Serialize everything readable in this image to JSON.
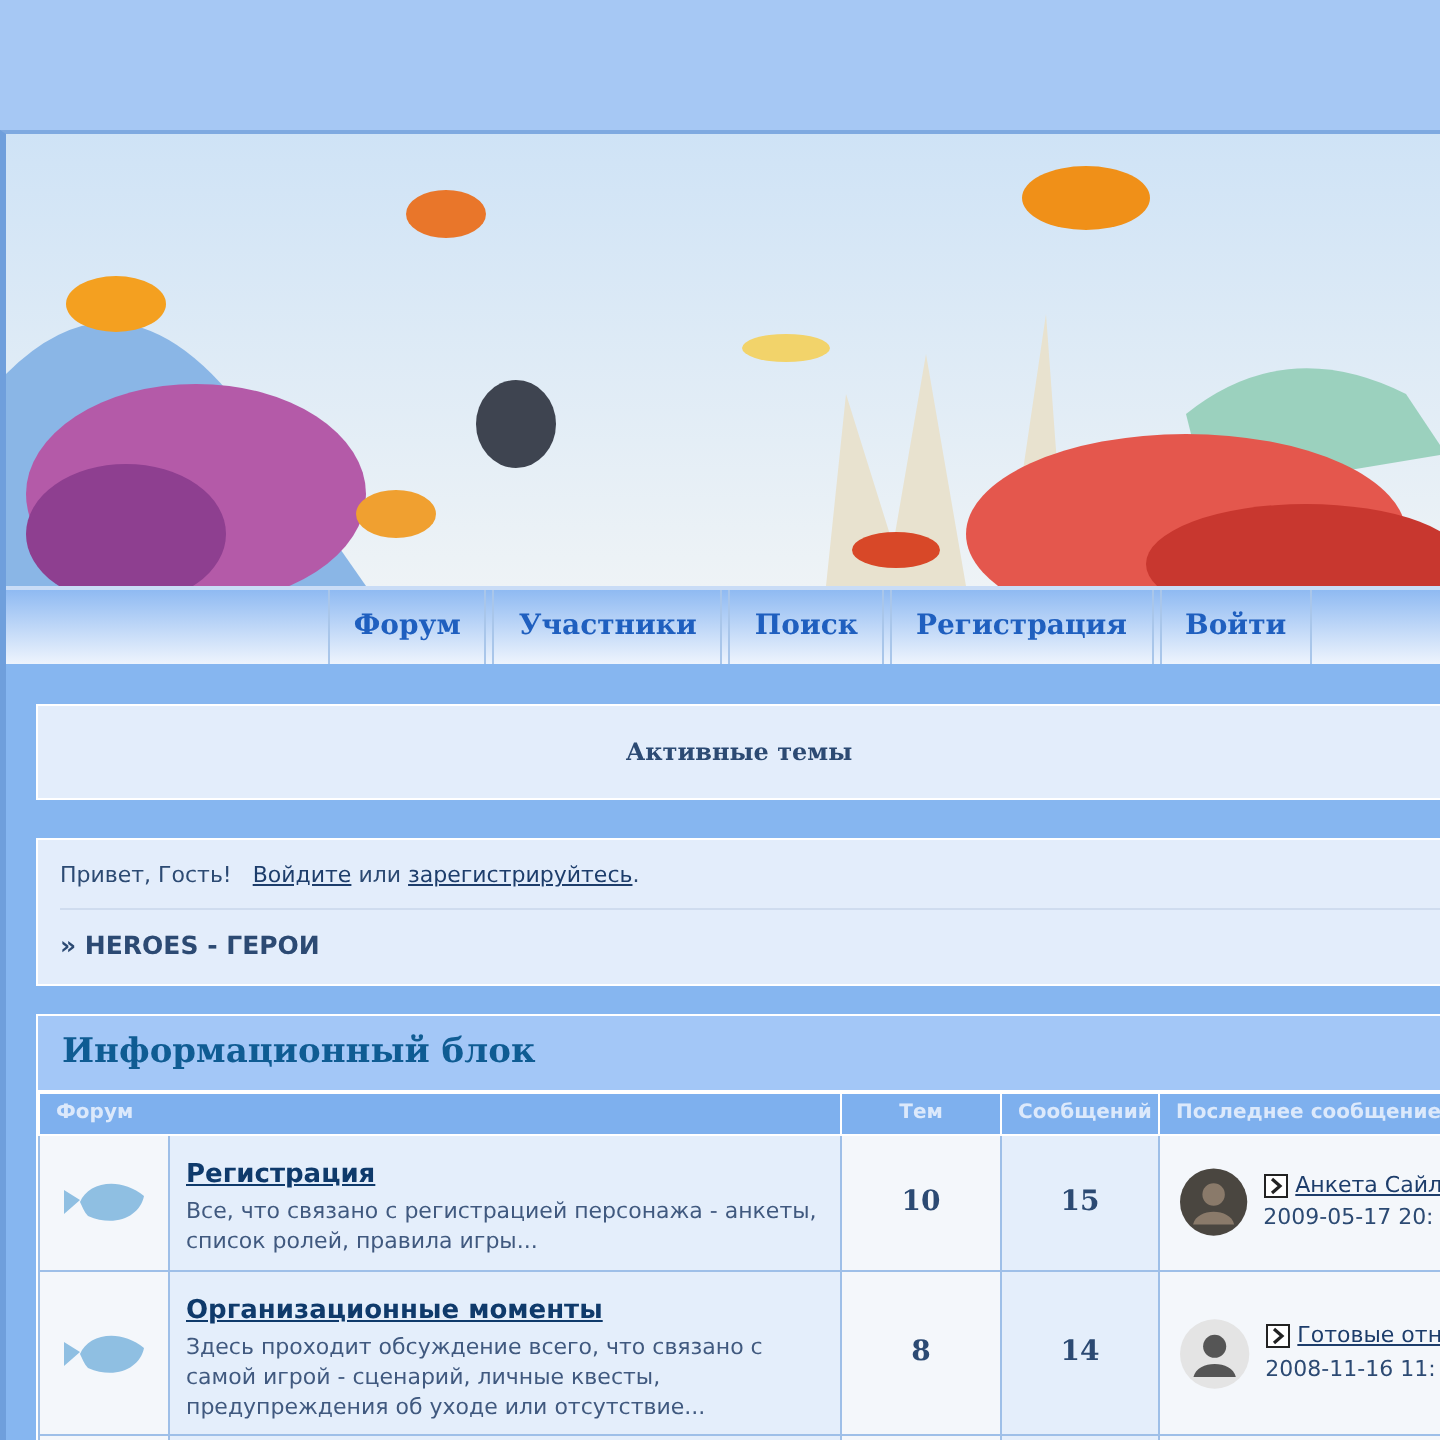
{
  "nav": [
    {
      "label": "Форум"
    },
    {
      "label": "Участники"
    },
    {
      "label": "Поиск"
    },
    {
      "label": "Регистрация"
    },
    {
      "label": "Войти"
    }
  ],
  "active_topics": "Активные темы",
  "welcome": {
    "greeting": "Привет, Гость!",
    "login_link": "Войдите",
    "joiner": "или",
    "register_link": "зарегистрируйтесь",
    "end": "."
  },
  "breadcrumb": "» HEROES - ГЕРОИ",
  "category": {
    "title": "Информационный блок",
    "columns": [
      "Форум",
      "Тем",
      "Сообщений",
      "Последнее сообщение"
    ],
    "forums": [
      {
        "name": "Регистрация",
        "description": "Все, что связано с регистрацией персонажа - анкеты, список ролей, правила игры...",
        "topics": "10",
        "posts": "15",
        "last_post": {
          "topic": "Анкета Сайл",
          "date": "2009-05-17 20:"
        }
      },
      {
        "name": "Организационные моменты",
        "description": "Здесь проходит обсуждение всего, что связано с самой игрой - сценарий, личные квесты, предупреждения об уходе или отсутствие...",
        "topics": "8",
        "posts": "14",
        "last_post": {
          "kind": "default",
          "topic": "Готовые отн",
          "date": "2008-11-16 11:"
        }
      }
    ]
  }
}
